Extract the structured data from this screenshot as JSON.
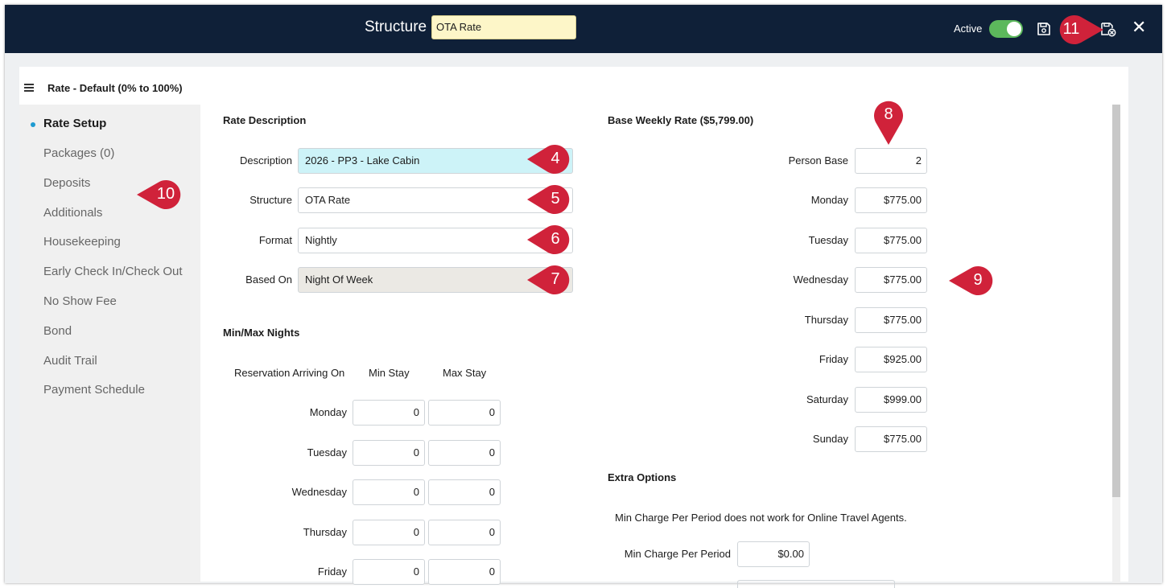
{
  "header": {
    "title": "Structure",
    "structure_value": "OTA Rate",
    "active_label": "Active",
    "active_on": true,
    "close_glyph": "✕",
    "accent": "#0f2038"
  },
  "panel": {
    "header": "Rate - Default (0% to 100%)"
  },
  "sidebar": {
    "items": [
      {
        "label": "Rate Setup"
      },
      {
        "label": "Packages (0)"
      },
      {
        "label": "Deposits"
      },
      {
        "label": "Additionals"
      },
      {
        "label": "Housekeeping"
      },
      {
        "label": "Early Check In/Check Out"
      },
      {
        "label": "No Show Fee"
      },
      {
        "label": "Bond"
      },
      {
        "label": "Audit Trail"
      },
      {
        "label": "Payment Schedule"
      }
    ]
  },
  "rate_description": {
    "title": "Rate Description",
    "fields": [
      {
        "label": "Description",
        "value": "2026 - PP3 - Lake Cabin"
      },
      {
        "label": "Structure",
        "value": "OTA Rate"
      },
      {
        "label": "Format",
        "value": "Nightly"
      },
      {
        "label": "Based On",
        "value": "Night Of Week"
      }
    ]
  },
  "min_max": {
    "title": "Min/Max Nights",
    "col_arriving": "Reservation Arriving On",
    "col_min": "Min Stay",
    "col_max": "Max Stay",
    "rows": [
      {
        "day": "Monday",
        "min": "0",
        "max": "0"
      },
      {
        "day": "Tuesday",
        "min": "0",
        "max": "0"
      },
      {
        "day": "Wednesday",
        "min": "0",
        "max": "0"
      },
      {
        "day": "Thursday",
        "min": "0",
        "max": "0"
      },
      {
        "day": "Friday",
        "min": "0",
        "max": "0"
      }
    ]
  },
  "base_weekly": {
    "title": "Base Weekly Rate ($5,799.00)",
    "rows": [
      {
        "label": "Person Base",
        "value": "2"
      },
      {
        "label": "Monday",
        "value": "$775.00"
      },
      {
        "label": "Tuesday",
        "value": "$775.00"
      },
      {
        "label": "Wednesday",
        "value": "$775.00"
      },
      {
        "label": "Thursday",
        "value": "$775.00"
      },
      {
        "label": "Friday",
        "value": "$925.00"
      },
      {
        "label": "Saturday",
        "value": "$999.00"
      },
      {
        "label": "Sunday",
        "value": "$775.00"
      }
    ]
  },
  "extra_options": {
    "title": "Extra Options",
    "note": "Min Charge Per Period does not work for Online Travel Agents.",
    "min_charge_label": "Min Charge Per Period",
    "min_charge_value": "$0.00"
  },
  "markers": [
    "4",
    "5",
    "6",
    "7",
    "8",
    "9",
    "10",
    "11"
  ],
  "marker_color": "#d0223a"
}
